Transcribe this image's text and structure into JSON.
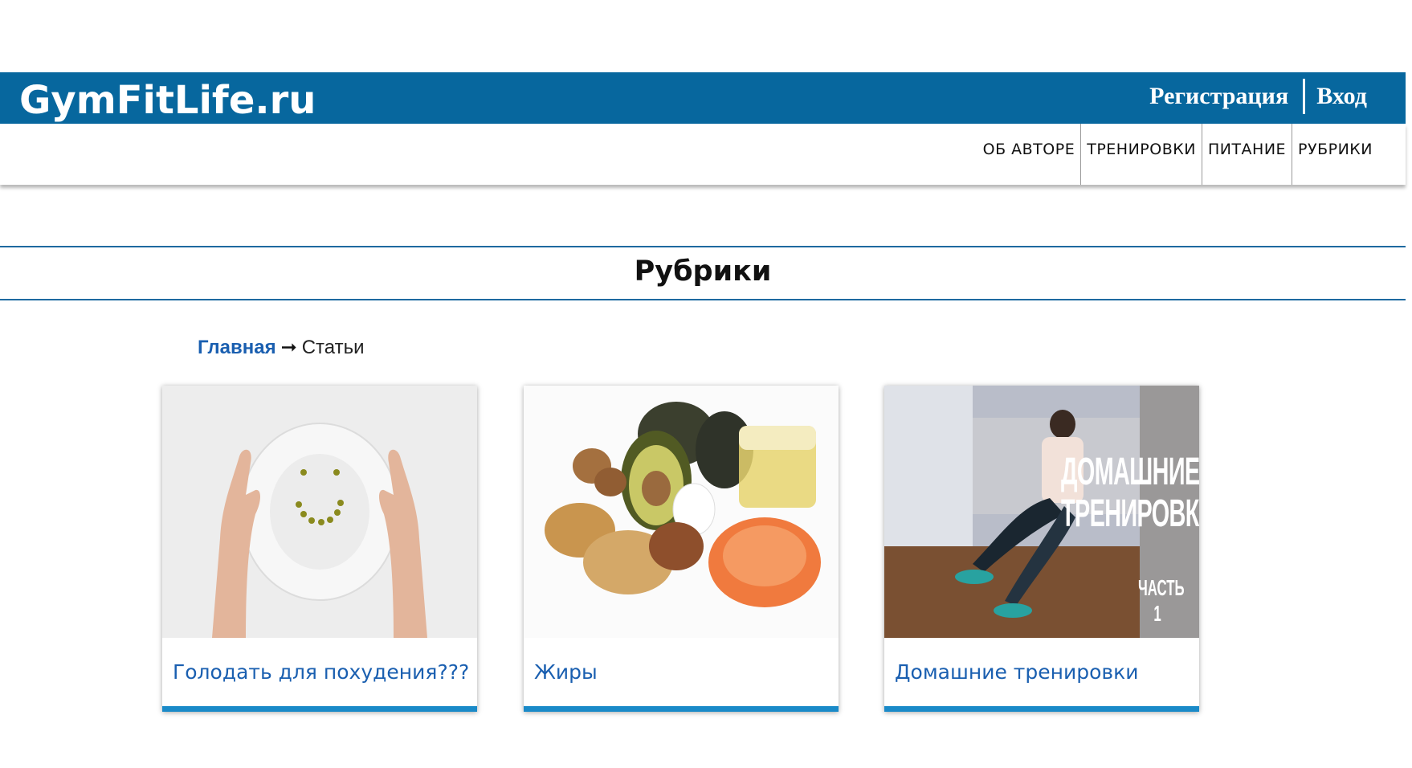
{
  "header": {
    "logo": "GymFitLife.ru",
    "register_label": "Регистрация",
    "login_label": "Вход"
  },
  "nav": {
    "items": [
      {
        "label": "ОБ АВТОРЕ"
      },
      {
        "label": "ТРЕНИРОВКИ"
      },
      {
        "label": "ПИТАНИЕ"
      },
      {
        "label": "РУБРИКИ"
      }
    ]
  },
  "page": {
    "title": "Рубрики"
  },
  "breadcrumb": {
    "home": "Главная",
    "arrow": "➞",
    "current": "Статьи"
  },
  "cards": [
    {
      "title": "Голодать для похудения???",
      "image": "plate-smiley-image"
    },
    {
      "title": "Жиры",
      "image": "healthy-fats-image"
    },
    {
      "title": "Домашние тренировки",
      "image": "home-workout-image",
      "image_text": [
        "ДОМАШНИЕ",
        "ТРЕНИРОВКИ",
        "ЧАСТЬ 1"
      ]
    }
  ],
  "colors": {
    "brand": "#07679e",
    "link": "#1a5fb0",
    "card_bar": "#1a8ac8"
  }
}
